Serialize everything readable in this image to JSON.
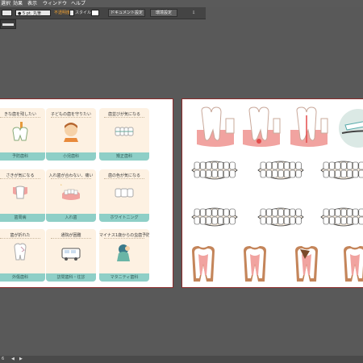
{
  "menubar": {
    "items": [
      "選択",
      "効果",
      "表示",
      "ウィンドウ",
      "ヘルプ"
    ]
  },
  "control_bar": {
    "stroke_value": "5 pt. 丸筆",
    "opacity_label": "不透明度",
    "style_label": "スタイル",
    "document_setup_button": "ドキュメント設定",
    "preferences_button": "環境設定"
  },
  "left_artboard": {
    "cards": [
      {
        "title": "きな歯を残したい",
        "footer": "予防歯科",
        "icon": "toothbrush-tooth-icon"
      },
      {
        "title": "子どもの歯を守りたい",
        "footer": "小児歯科",
        "icon": "child-icon"
      },
      {
        "title": "歯並びが気になる",
        "footer": "矯正歯科",
        "icon": "braces-icon"
      },
      {
        "title": "さきが気になる",
        "footer": "歯周病",
        "icon": "gum-tooth-icon"
      },
      {
        "title": "入れ歯が合わない、痛い",
        "footer": "入れ歯",
        "icon": "denture-icon"
      },
      {
        "title": "歯の色が気になる",
        "footer": "ホワイトニング",
        "icon": "white-teeth-icon"
      },
      {
        "title": "歯が折れた",
        "footer": "外傷歯科",
        "icon": "broken-tooth-icon"
      },
      {
        "title": "通院が困難",
        "footer": "訪問歯科・往診",
        "icon": "car-icon"
      },
      {
        "title": "マイナス1歳からの虫歯予防",
        "footer": "マタニティ歯科",
        "icon": "pregnant-icon"
      }
    ]
  },
  "colors": {
    "workspace": "#595959",
    "card_bg": "#fdf1e2",
    "card_footer": "#8ecfc7",
    "tooth_fill": "#ffffff",
    "gum": "#f1a3a0",
    "artboard_border": "#8b2a2a"
  },
  "statusbar": {
    "zoom_text": "6",
    "nav_left": "◀",
    "nav_right": "▶"
  }
}
